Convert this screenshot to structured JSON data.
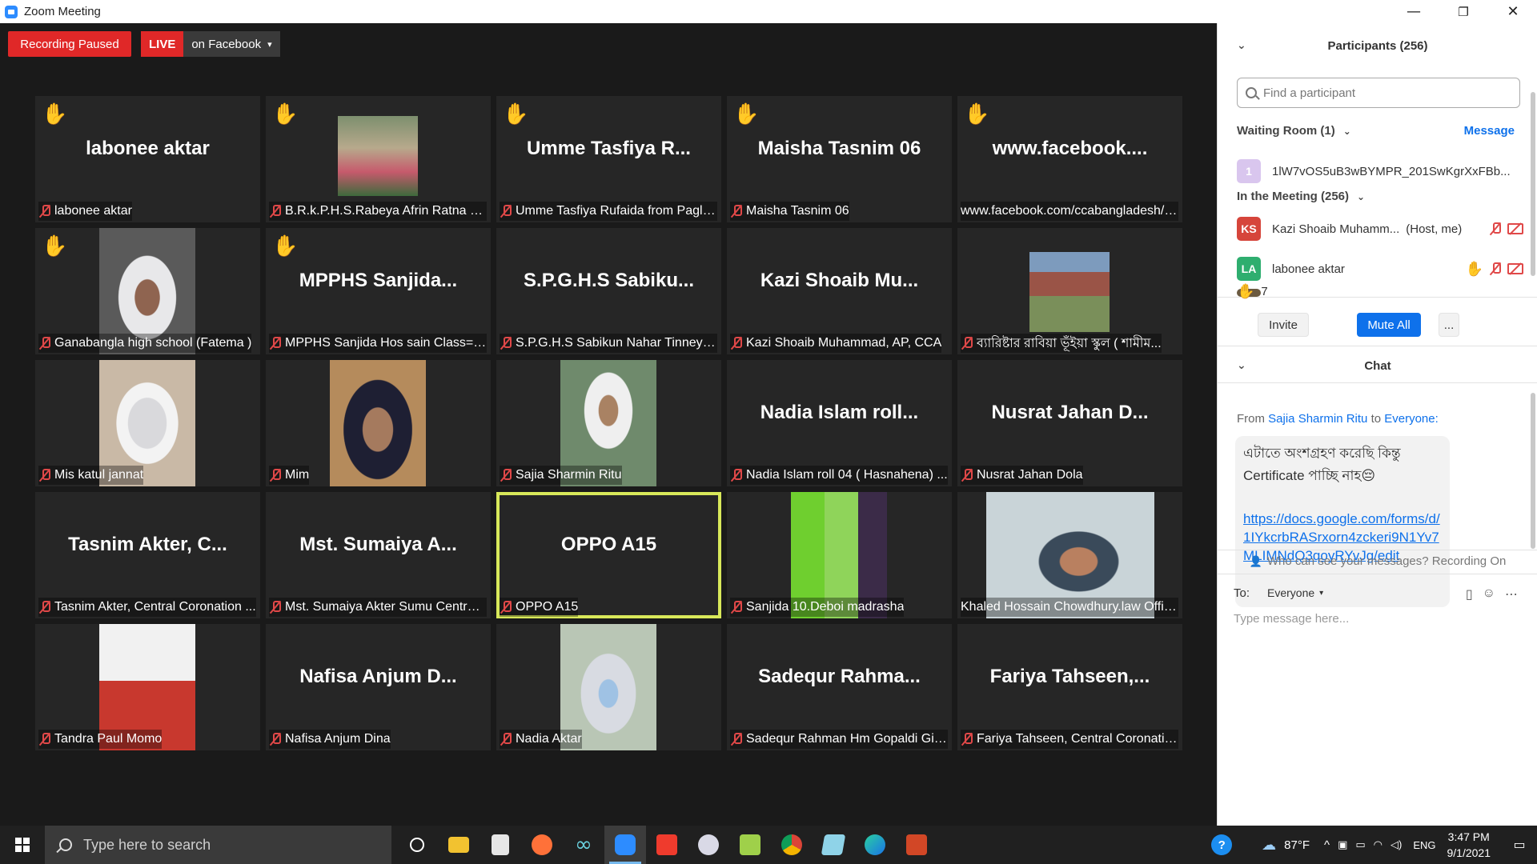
{
  "window": {
    "title": "Zoom Meeting",
    "controls": {
      "minimize": "—",
      "restore": "❐",
      "close": "✕"
    }
  },
  "top_bar": {
    "recording_label": "Recording Paused",
    "live_label": "LIVE",
    "stream_label": "on Facebook",
    "dropdown_glyph": "▾"
  },
  "tiles": [
    {
      "big": "labonee aktar",
      "label": "labonee aktar",
      "hand": true,
      "photo": null
    },
    {
      "big": "",
      "label": "B.R.k.P.H.S.Rabeya Afrin Ratna clas...",
      "hand": true,
      "photo": "monument"
    },
    {
      "big": "Umme  Tasfiya  R...",
      "label": "Umme Tasfiya Rufaida from Pagla ...",
      "hand": true,
      "photo": null
    },
    {
      "big": "Maisha Tasnim 06",
      "label": "Maisha Tasnim 06",
      "hand": true,
      "photo": null
    },
    {
      "big": "www.facebook....",
      "label": "www.facebook.com/ccabangladesh/li...",
      "hand": true,
      "photo": null,
      "no_mic": true
    },
    {
      "big": "",
      "label": "Ganabangla high school (Fatema )",
      "hand": true,
      "photo": "girl-white-hijab"
    },
    {
      "big": "MPPHS  Sanjida...",
      "label": "MPPHS Sanjida Hos sain Class=10",
      "hand": true,
      "photo": null
    },
    {
      "big": "S.P.G.H.S  Sabiku...",
      "label": "S.P.G.H.S Sabikun Nahar Tinney ro...",
      "hand": false,
      "photo": null
    },
    {
      "big": "Kazi  Shoaib  Mu...",
      "label": "Kazi Shoaib Muhammad, AP, CCA",
      "hand": false,
      "photo": null
    },
    {
      "big": "",
      "label": "ব্যারিষ্টার রাবিয়া ভূঁইয়া স্কুল ( শামীম...",
      "hand": false,
      "photo": "man-outdoor"
    },
    {
      "big": "",
      "label": "Mis katul jannat",
      "hand": false,
      "photo": "girl-mask"
    },
    {
      "big": "",
      "label": "Mim",
      "hand": false,
      "photo": "girl-dark-hijab"
    },
    {
      "big": "",
      "label": "Sajia Sharmin Ritu",
      "hand": false,
      "photo": "girl-classroom"
    },
    {
      "big": "Nadia  Islam  roll...",
      "label": "Nadia Islam roll 04  ( Hasnahena) ...",
      "hand": false,
      "photo": null
    },
    {
      "big": "Nusrat  Jahan  D...",
      "label": "Nusrat Jahan Dola",
      "hand": false,
      "photo": null
    },
    {
      "big": "Tasnim  Akter,  C...",
      "label": "Tasnim Akter, Central Coronation ...",
      "hand": false,
      "photo": null
    },
    {
      "big": "Mst.  Sumaiya  A...",
      "label": "Mst. Sumaiya Akter Sumu Central...",
      "hand": false,
      "photo": null
    },
    {
      "big": "OPPO A15",
      "label": "OPPO A15",
      "hand": false,
      "photo": null,
      "active": true
    },
    {
      "big": "",
      "label": "Sanjida 10.Deboi madrasha",
      "hand": false,
      "photo": "green-room"
    },
    {
      "big": "",
      "label": "Khaled Hossain Chowdhury.law Offic...",
      "hand": false,
      "photo": "man-headset",
      "no_mic": true
    },
    {
      "big": "",
      "label": "Tandra Paul Momo",
      "hand": false,
      "photo": "man-red"
    },
    {
      "big": "Nafisa  Anjum  D...",
      "label": "Nafisa Anjum Dina",
      "hand": false,
      "photo": null
    },
    {
      "big": "",
      "label": "Nadia Aktar",
      "hand": false,
      "photo": "girl-mask-blue"
    },
    {
      "big": "Sadequr  Rahma...",
      "label": "Sadequr Rahman Hm Gopaldi Girl...",
      "hand": false,
      "photo": null
    },
    {
      "big": "Fariya  Tahseen,...",
      "label": "Fariya Tahseen, Central Coronation...",
      "hand": false,
      "photo": null
    }
  ],
  "participants": {
    "header": "Participants (256)",
    "search_placeholder": "Find a participant",
    "waiting_room": {
      "title": "Waiting Room (1)",
      "message_label": "Message",
      "entry": {
        "initial": "1",
        "name": "1lW7vOS5uB3wBYMPR_201SwKgrXxFBb..."
      }
    },
    "in_meeting": {
      "title": "In the Meeting (256)",
      "rows": [
        {
          "initials": "KS",
          "name": "Kazi Shoaib Muhamm...",
          "role": "(Host, me)",
          "color": "#d6453b"
        },
        {
          "initials": "LA",
          "name": "labonee aktar",
          "role": "",
          "color": "#2eae6f"
        }
      ]
    },
    "raised_hands": "7",
    "buttons": {
      "invite": "Invite",
      "mute_all": "Mute All",
      "more": "..."
    }
  },
  "chat": {
    "header": "Chat",
    "from_prefix": "From",
    "from_name": "Sajia Sharmin Ritu",
    "to_word": "to",
    "to_name": "Everyone:",
    "message_text": "এটাতে অংশগ্রহণ করেছি কিন্তু Certificate পাচ্ছি নাহ😔",
    "message_link": "https://docs.google.com/forms/d/1IYkcrbRASrxorn4zckeri9N1Yv7MLIMNdQ3qoyRYvJg/edit",
    "who_can_see": "Who can see your messages? Recording On",
    "to_label": "To:",
    "to_value": "Everyone",
    "input_placeholder": "Type message here..."
  },
  "taskbar": {
    "search_placeholder": "Type here to search",
    "weather": "87°F",
    "language": "ENG",
    "time": "3:47 PM",
    "date": "9/1/2021"
  },
  "colors": {
    "recording_red": "#e02828",
    "active_speaker": "#d8e85a",
    "zoom_blue": "#0e71eb"
  }
}
